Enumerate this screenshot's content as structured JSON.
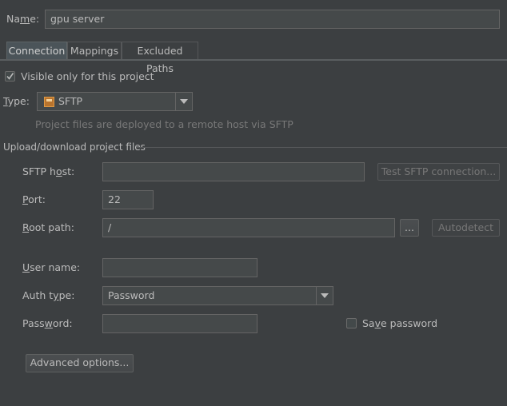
{
  "name": {
    "label_prefix": "Na",
    "label_mn": "m",
    "label_rest": "e:",
    "value": "gpu server"
  },
  "tabs": [
    {
      "label": "Connection"
    },
    {
      "label": "Mappings"
    },
    {
      "label": "Excluded Paths"
    }
  ],
  "visible_only": {
    "label": "Visible only for this project",
    "checked": true
  },
  "type": {
    "label_prefix": "",
    "label_mn": "T",
    "label_rest": "ype:",
    "value": "SFTP",
    "hint": "Project files are deployed to a remote host via SFTP"
  },
  "section_title": "Upload/download project files",
  "sftp_host": {
    "label_a": "SFTP h",
    "label_mn": "o",
    "label_b": "st:",
    "value": "",
    "test_button": "Test SFTP connection..."
  },
  "port": {
    "label_mn": "P",
    "label_rest": "ort:",
    "value": "22"
  },
  "root_path": {
    "label_mn": "R",
    "label_rest": "oot path:",
    "value": "/",
    "browse_button": "...",
    "autodetect_button": "Autodetect"
  },
  "user_name": {
    "label_mn": "U",
    "label_rest": "ser name:",
    "value": ""
  },
  "auth_type": {
    "label_a": "Auth t",
    "label_mn": "y",
    "label_b": "pe:",
    "value": "Password"
  },
  "password": {
    "label_a": "Pass",
    "label_mn": "w",
    "label_b": "ord:",
    "value": ""
  },
  "save_password": {
    "label_a": "Sa",
    "label_mn": "v",
    "label_b": "e password",
    "checked": false
  },
  "advanced_button": "Advanced options..."
}
